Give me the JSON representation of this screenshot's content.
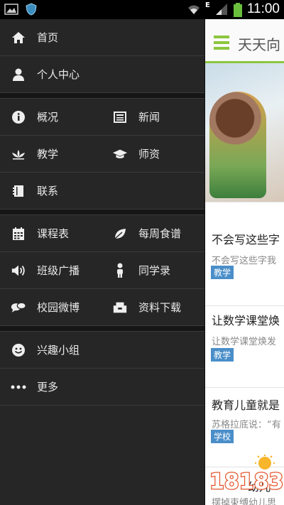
{
  "status_bar": {
    "time": "11:00",
    "network_label": "E"
  },
  "drawer": {
    "items": [
      {
        "label": "首页",
        "icon": "home-icon"
      },
      {
        "label": "个人中心",
        "icon": "user-icon"
      },
      {
        "label": "概况",
        "icon": "info-icon"
      },
      {
        "label": "新闻",
        "icon": "news-icon"
      },
      {
        "label": "教学",
        "icon": "lotus-icon"
      },
      {
        "label": "师资",
        "icon": "graduation-cap-icon"
      },
      {
        "label": "联系",
        "icon": "address-book-icon"
      },
      {
        "label": "课程表",
        "icon": "calendar-icon"
      },
      {
        "label": "每周食谱",
        "icon": "leaf-icon"
      },
      {
        "label": "班级广播",
        "icon": "speaker-icon"
      },
      {
        "label": "同学录",
        "icon": "person-icon"
      },
      {
        "label": "校园微博",
        "icon": "chat-bubbles-icon"
      },
      {
        "label": "资料下载",
        "icon": "download-box-icon"
      },
      {
        "label": "兴趣小组",
        "icon": "smiley-icon"
      },
      {
        "label": "更多",
        "icon": "more-dots-icon"
      }
    ]
  },
  "content": {
    "app_title": "天天向",
    "news": [
      {
        "title": "不会写这些字",
        "snippet": "不会写这些字我",
        "tag": "教学"
      },
      {
        "title": "让数学课堂焕",
        "snippet": "让数学课堂焕发",
        "tag": "教学"
      },
      {
        "title": "教育儿童就是",
        "snippet": "苏格拉底说：“有",
        "tag": "学校"
      },
      {
        "title": "幼儿",
        "snippet": "摆掉束缚幼儿思"
      }
    ]
  },
  "watermark": {
    "text": "18183"
  },
  "colors": {
    "accent": "#8dc63f",
    "tag": "#4a8ec9",
    "drawer_bg": "#262626"
  }
}
